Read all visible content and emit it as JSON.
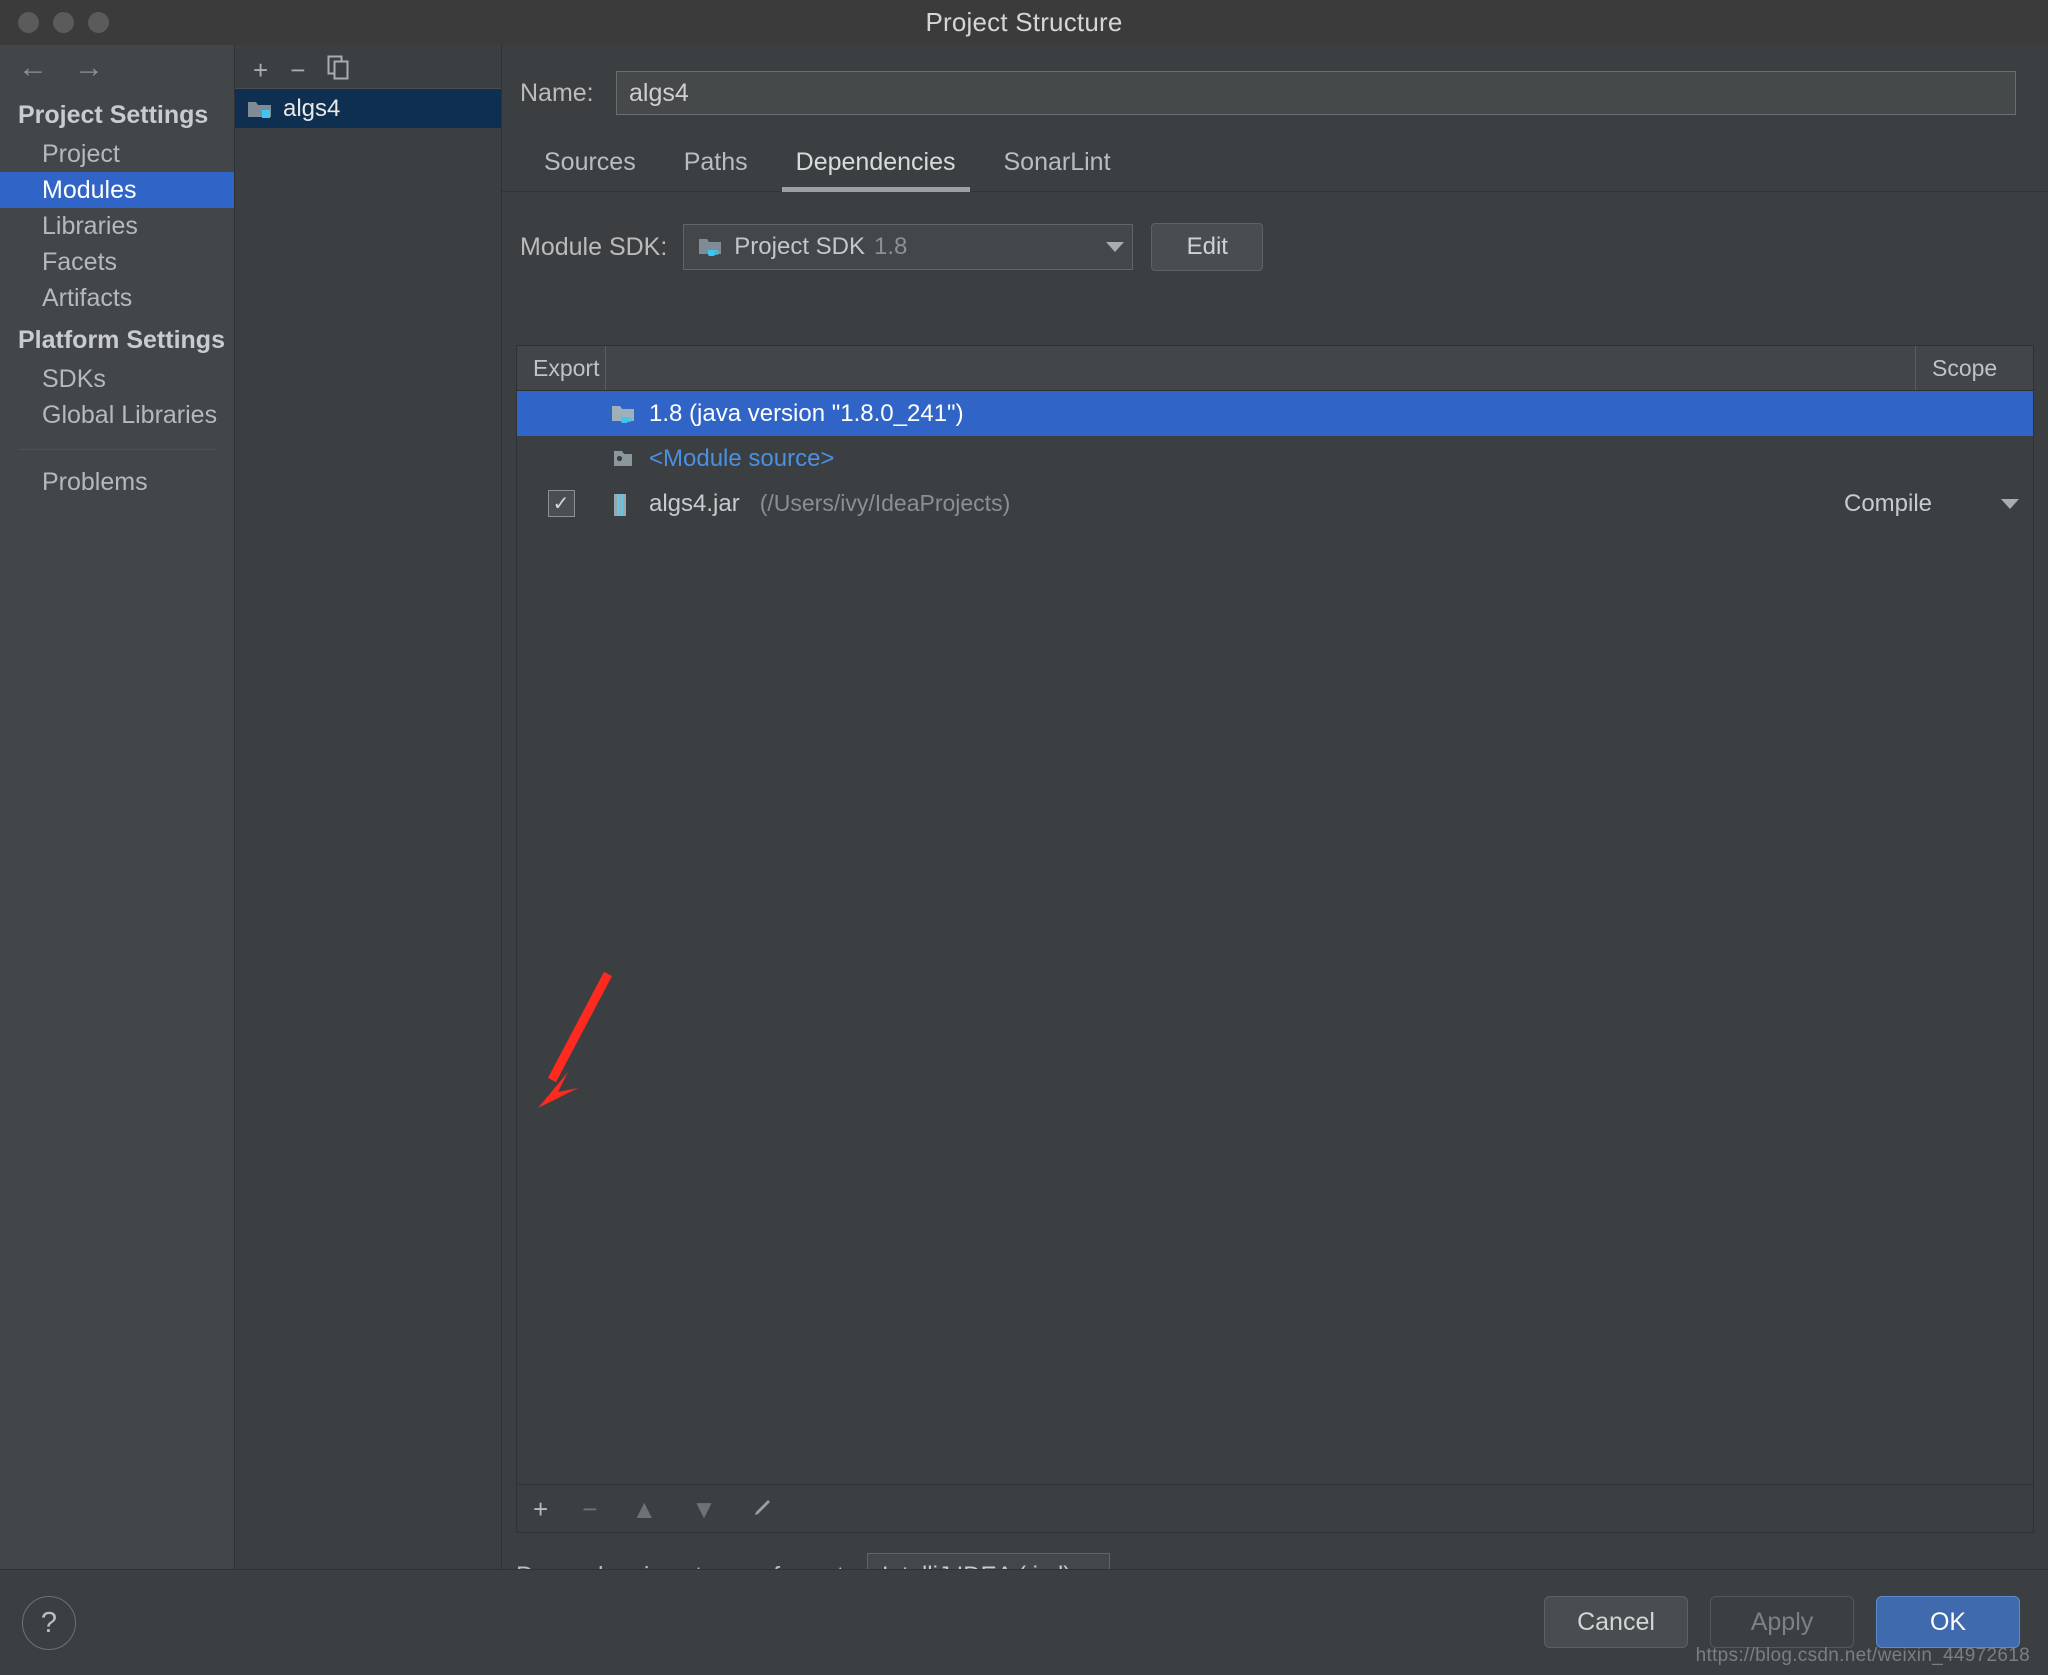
{
  "window": {
    "title": "Project Structure",
    "traffic_lights": [
      "close-button",
      "minimize-button",
      "zoom-button"
    ]
  },
  "nav": {
    "back": "←",
    "forward": "→"
  },
  "sidebar": {
    "groups": [
      {
        "title": "Project Settings",
        "items": [
          {
            "label": "Project",
            "selected": false
          },
          {
            "label": "Modules",
            "selected": true
          },
          {
            "label": "Libraries",
            "selected": false
          },
          {
            "label": "Facets",
            "selected": false
          },
          {
            "label": "Artifacts",
            "selected": false
          }
        ]
      },
      {
        "title": "Platform Settings",
        "items": [
          {
            "label": "SDKs",
            "selected": false
          },
          {
            "label": "Global Libraries",
            "selected": false
          }
        ]
      }
    ],
    "problems": "Problems"
  },
  "modules_panel": {
    "toolbar": {
      "add": "+",
      "remove": "−",
      "copy": "copy-icon"
    },
    "items": [
      {
        "label": "algs4",
        "selected": true
      }
    ]
  },
  "main": {
    "name_label": "Name:",
    "name_value": "algs4",
    "name_placeholder": "",
    "tabs": [
      {
        "label": "Sources",
        "active": false
      },
      {
        "label": "Paths",
        "active": false
      },
      {
        "label": "Dependencies",
        "active": true
      },
      {
        "label": "SonarLint",
        "active": false
      }
    ],
    "module_sdk_label": "Module SDK:",
    "module_sdk_value": "Project SDK",
    "module_sdk_version": "1.8",
    "edit_button": "Edit",
    "table": {
      "columns": {
        "export": "Export",
        "name": "",
        "scope": "Scope"
      },
      "rows": [
        {
          "export_checked": null,
          "icon": "jdk-folder-icon",
          "name": "1.8 (java version \"1.8.0_241\")",
          "name_style": "white",
          "detail": "",
          "scope": "",
          "selected": true
        },
        {
          "export_checked": null,
          "icon": "module-source-icon",
          "name": "<Module source>",
          "name_style": "blue",
          "detail": "",
          "scope": "",
          "selected": false
        },
        {
          "export_checked": true,
          "icon": "jar-icon",
          "name": "algs4.jar",
          "name_style": "plain",
          "detail": "(/Users/ivy/IdeaProjects)",
          "scope": "Compile",
          "selected": false
        }
      ]
    },
    "bottom_toolbar": {
      "add": "+",
      "remove": "−",
      "move_up": "▲",
      "move_down": "▼",
      "edit": "edit-pencil-icon"
    },
    "storage_label": "Dependencies storage format:",
    "storage_value": "IntelliJ IDEA (.iml)"
  },
  "footer": {
    "help": "?",
    "cancel": "Cancel",
    "apply": "Apply",
    "ok": "OK",
    "watermark": "https://blog.csdn.net/weixin_44972618"
  },
  "colors": {
    "accent": "#3064c7",
    "selection": "#0e2f4f",
    "link": "#4a90e2",
    "ok_button": "#3f6aad",
    "annotation_arrow": "#ff2a1f"
  }
}
